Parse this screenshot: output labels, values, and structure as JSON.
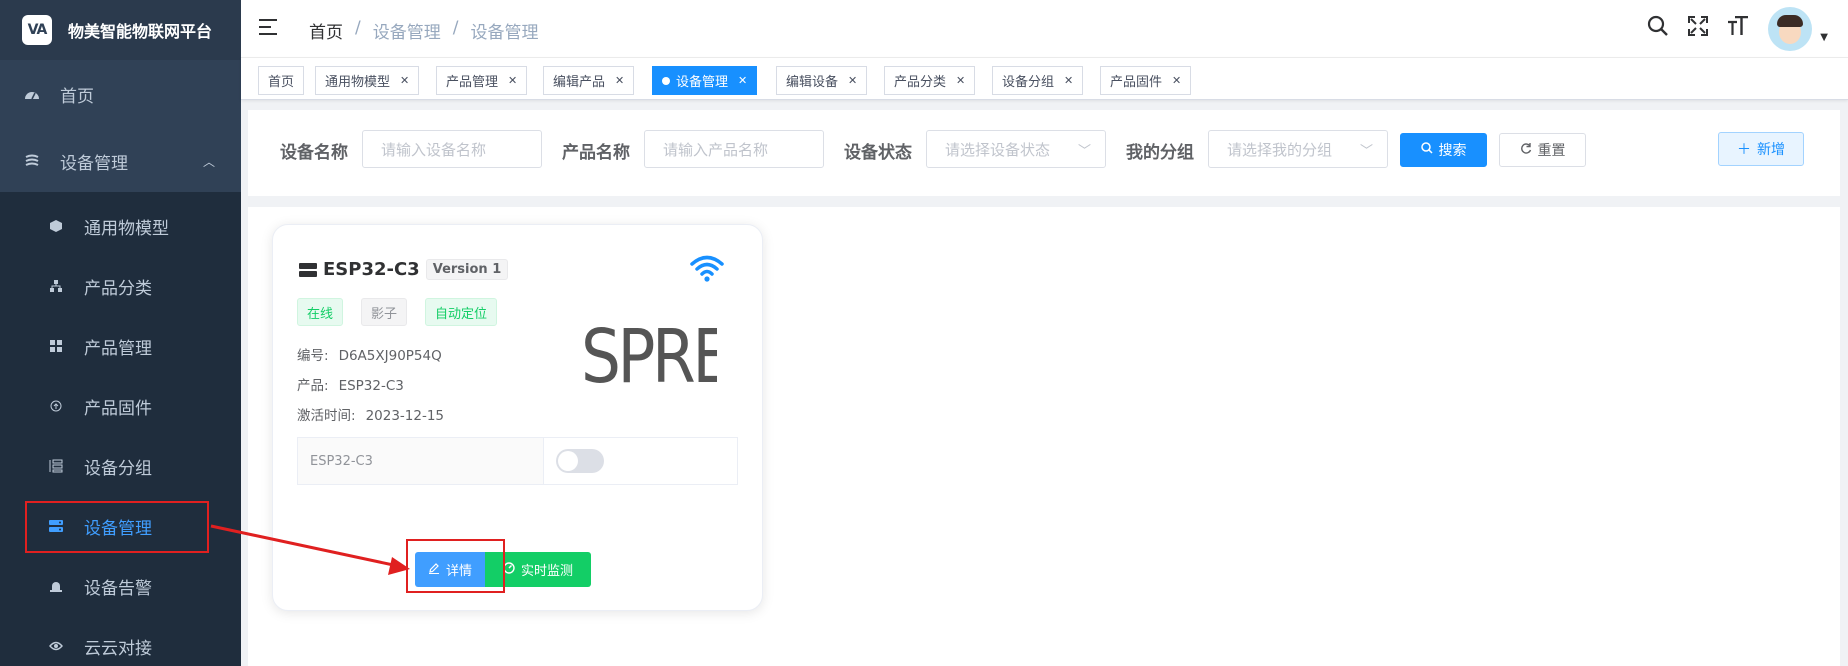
{
  "brand": {
    "logo_text": "VA",
    "name": "物美智能物联网平台"
  },
  "sidebar": {
    "home": "首页",
    "group": "设备管理",
    "items": [
      {
        "label": "通用物模型",
        "icon": "cube-icon"
      },
      {
        "label": "产品分类",
        "icon": "tree-icon"
      },
      {
        "label": "产品管理",
        "icon": "grid-icon"
      },
      {
        "label": "产品固件",
        "icon": "upload-icon"
      },
      {
        "label": "设备分组",
        "icon": "group-icon"
      },
      {
        "label": "设备管理",
        "icon": "server-icon"
      },
      {
        "label": "设备告警",
        "icon": "alarm-icon"
      },
      {
        "label": "云云对接",
        "icon": "eye-icon"
      }
    ]
  },
  "header": {
    "breadcrumb": [
      "首页",
      "/",
      "设备管理",
      "/",
      "设备管理"
    ]
  },
  "tags": [
    {
      "label": "首页"
    },
    {
      "label": "通用物模型"
    },
    {
      "label": "产品管理"
    },
    {
      "label": "编辑产品"
    },
    {
      "label": "设备管理",
      "active": true
    },
    {
      "label": "编辑设备"
    },
    {
      "label": "产品分类"
    },
    {
      "label": "设备分组"
    },
    {
      "label": "产品固件"
    }
  ],
  "search": {
    "device_name_label": "设备名称",
    "device_name_placeholder": "请输入设备名称",
    "product_name_label": "产品名称",
    "product_name_placeholder": "请输入产品名称",
    "status_label": "设备状态",
    "status_placeholder": "请选择设备状态",
    "group_label": "我的分组",
    "group_placeholder": "请选择我的分组",
    "search_btn": "搜索",
    "reset_btn": "重置",
    "add_btn": "新增"
  },
  "device_card": {
    "name": "ESP32-C3",
    "version": "Version 1",
    "tags": [
      "在线",
      "影子",
      "自动定位"
    ],
    "id_label": "编号:",
    "id_value": "D6A5XJ90P54Q",
    "product_label": "产品:",
    "product_value": "ESP32-C3",
    "activated_label": "激活时间:",
    "activated_value": "2023-12-15",
    "logo_text": "SPRE",
    "table_cell": "ESP32-C3",
    "switch_on": false,
    "detail_btn": "详情",
    "monitor_btn": "实时监测"
  },
  "colors": {
    "primary": "#1890ff",
    "success": "#13ce66",
    "sidebar": "#304156",
    "annotation": "#e02020"
  }
}
